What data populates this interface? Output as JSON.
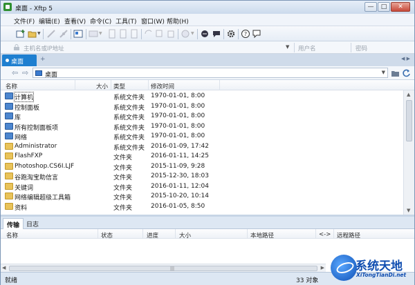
{
  "window": {
    "title": "桌面 - Xftp 5",
    "controls": [
      "—",
      "□",
      "✕"
    ]
  },
  "menu": [
    "文件(F)",
    "编辑(E)",
    "查看(V)",
    "命令(C)",
    "工具(T)",
    "窗口(W)",
    "帮助(H)"
  ],
  "address": {
    "host_placeholder": "主机名或IP地址",
    "user_placeholder": "用户名",
    "pass_placeholder": "密码"
  },
  "tabs": {
    "active_label": "桌面",
    "add_label": "+"
  },
  "path": {
    "current": "桌面"
  },
  "filelist": {
    "columns": {
      "name": "名称",
      "size": "大小",
      "type": "类型",
      "modified": "修改时间"
    },
    "rows": [
      {
        "name": "计算机",
        "size": "",
        "type": "系统文件夹",
        "modified": "1970-01-01, 8:00",
        "icon": "computer-icon"
      },
      {
        "name": "控制面板",
        "size": "",
        "type": "系统文件夹",
        "modified": "1970-01-01, 8:00",
        "icon": "control-panel-icon"
      },
      {
        "name": "库",
        "size": "",
        "type": "系统文件夹",
        "modified": "1970-01-01, 8:00",
        "icon": "library-icon"
      },
      {
        "name": "所有控制面板项",
        "size": "",
        "type": "系统文件夹",
        "modified": "1970-01-01, 8:00",
        "icon": "control-panel-icon"
      },
      {
        "name": "网络",
        "size": "",
        "type": "系统文件夹",
        "modified": "1970-01-01, 8:00",
        "icon": "network-icon"
      },
      {
        "name": "Administrator",
        "size": "",
        "type": "系统文件夹",
        "modified": "2016-01-09, 17:42",
        "icon": "folder-icon"
      },
      {
        "name": "FlashFXP",
        "size": "",
        "type": "文件夹",
        "modified": "2016-01-11, 14:25",
        "icon": "folder-icon"
      },
      {
        "name": "Photoshop.CS6I.LJF",
        "size": "",
        "type": "文件夹",
        "modified": "2015-11-09, 9:28",
        "icon": "folder-icon"
      },
      {
        "name": "谷跑淘宝助信言",
        "size": "",
        "type": "文件夹",
        "modified": "2015-12-30, 18:03",
        "icon": "folder-icon"
      },
      {
        "name": "关键词",
        "size": "",
        "type": "文件夹",
        "modified": "2016-01-11, 12:04",
        "icon": "folder-icon"
      },
      {
        "name": "网络编辑超级工具箱",
        "size": "",
        "type": "文件夹",
        "modified": "2015-10-20, 10:14",
        "icon": "folder-icon"
      },
      {
        "name": "资料",
        "size": "",
        "type": "文件夹",
        "modified": "2016-01-05, 8:50",
        "icon": "folder-icon"
      }
    ]
  },
  "bottom_tabs": [
    "传输",
    "日志"
  ],
  "transfer": {
    "columns": {
      "name": "名称",
      "status": "状态",
      "progress": "进度",
      "size": "大小",
      "local": "本地路径",
      "dir": "<->",
      "remote": "远程路径"
    }
  },
  "status": {
    "left": "就绪",
    "count": "33 对象"
  },
  "watermark": {
    "title": "系统天地",
    "url": "XiTongTianDi.net"
  }
}
